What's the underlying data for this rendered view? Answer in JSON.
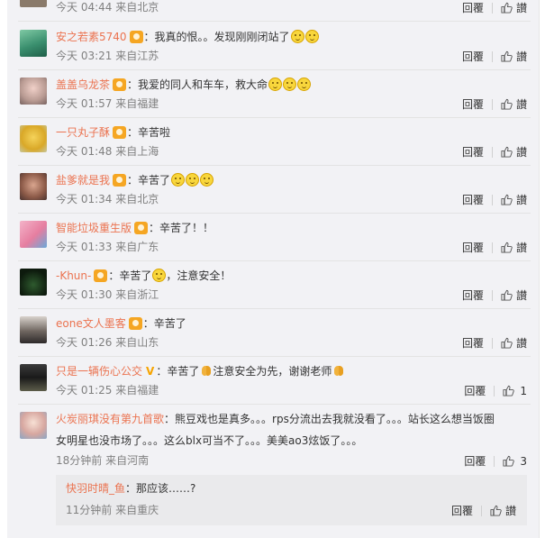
{
  "colors": {
    "username": "#eb7350",
    "meta": "#808080",
    "panel": "#f2f2f5"
  },
  "comments": [
    {
      "user": "",
      "text": "",
      "meta": "今天 04:44 来自北京",
      "reply": "回覆",
      "like": "讃",
      "likes": ""
    },
    {
      "user": "安之若素5740",
      "text": "：我真的恨。。发现刚刚闭站了",
      "meta": "今天 03:21 来自江苏",
      "reply": "回覆",
      "like": "讃",
      "likes": ""
    },
    {
      "user": "盖盖乌龙茶",
      "text": "：我爱的同人和车车，救大命",
      "meta": "今天 01:57 来自福建",
      "reply": "回覆",
      "like": "讃",
      "likes": ""
    },
    {
      "user": "一只丸子酥",
      "text": "：辛苦啦",
      "meta": "今天 01:48 来自上海",
      "reply": "回覆",
      "like": "讃",
      "likes": ""
    },
    {
      "user": "盐爹就是我",
      "text": "：辛苦了",
      "meta": "今天 01:34 来自北京",
      "reply": "回覆",
      "like": "讃",
      "likes": ""
    },
    {
      "user": "智能垃圾重生版",
      "text": "：辛苦了！！",
      "meta": "今天 01:33 来自广东",
      "reply": "回覆",
      "like": "讃",
      "likes": ""
    },
    {
      "user": "-Khun-",
      "text": "：辛苦了",
      "text2": "，注意安全！",
      "meta": "今天 01:30 来自浙江",
      "reply": "回覆",
      "like": "讃",
      "likes": ""
    },
    {
      "user": "eone文人墨客",
      "text": "：辛苦了",
      "meta": "今天 01:26 来自山东",
      "reply": "回覆",
      "like": "讃",
      "likes": ""
    },
    {
      "user": "只是一辆伤心公交",
      "text": "：辛苦了",
      "text2": "注意安全为先，谢谢老师",
      "meta": "今天 01:25 来自福建",
      "reply": "回覆",
      "like": "",
      "likes": "1"
    },
    {
      "user": "火炭丽琪没有第九首歌",
      "text": "：熊豆戏也是真多。。。rps分流出去我就没看了。。。站长这么想当饭圈",
      "text_line2": "女明星也没市场了。。。这么blx可当不了。。。美美ao3炫饭了。。。",
      "meta": "18分钟前 来自河南",
      "reply": "回覆",
      "like": "",
      "likes": "3"
    }
  ],
  "sub_reply": {
    "user": "快羽时晴_鱼",
    "text": "：那应该……?",
    "meta": "11分钟前 来自重庆",
    "reply": "回覆",
    "like": "讃"
  }
}
